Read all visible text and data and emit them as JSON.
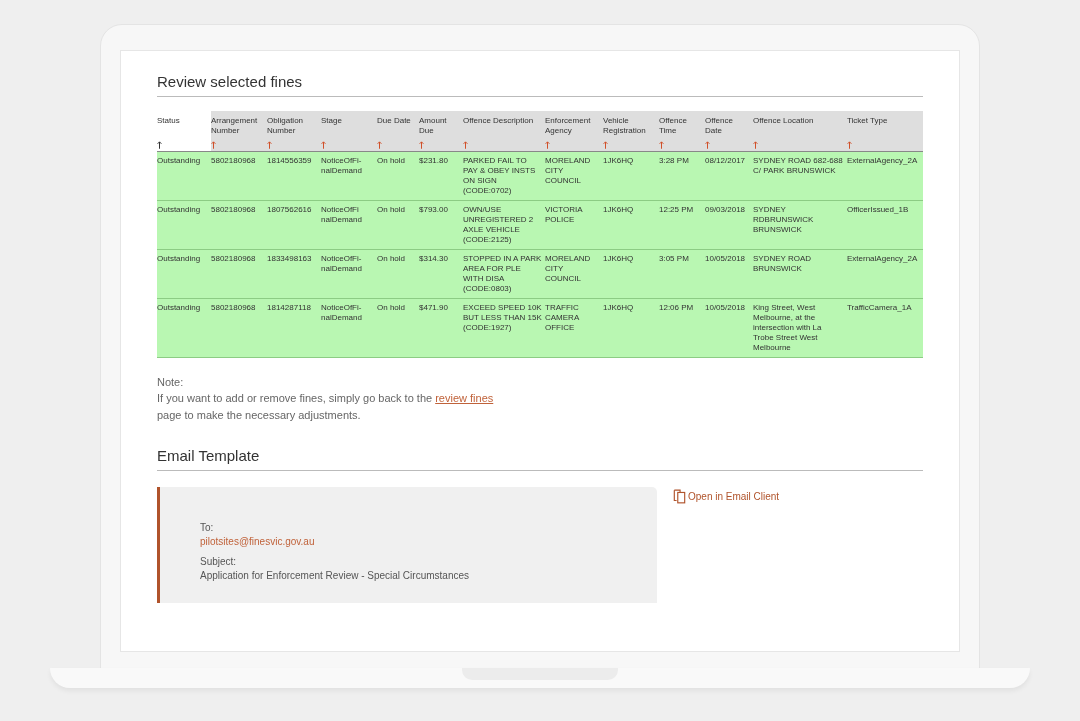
{
  "review": {
    "title": "Review selected fines",
    "table": {
      "columns": [
        {
          "label": "Status",
          "shaded": false
        },
        {
          "label": "Arrangement Number",
          "shaded": true
        },
        {
          "label": "Obligation Number",
          "shaded": true
        },
        {
          "label": "Stage",
          "shaded": true
        },
        {
          "label": "Due Date",
          "shaded": true
        },
        {
          "label": "Amount Due",
          "shaded": true
        },
        {
          "label": "Offence Description",
          "shaded": true
        },
        {
          "label": "Enforcement Agency",
          "shaded": true
        },
        {
          "label": "Vehicle Registration",
          "shaded": true
        },
        {
          "label": "Offence Time",
          "shaded": true
        },
        {
          "label": "Offence Date",
          "shaded": true
        },
        {
          "label": "Offence Location",
          "shaded": true
        },
        {
          "label": "Ticket Type",
          "shaded": true
        }
      ],
      "rows": [
        {
          "highlighted": true,
          "cells": [
            "Outstanding",
            "5802180968",
            "1814556359",
            "NoticeOfFi-nalDemand",
            "On hold",
            "$231.80",
            "PARKED FAIL TO PAY & OBEY INSTS ON SIGN (CODE:0702)",
            "MORELAND CITY COUNCIL",
            "1JK6HQ",
            "3:28 PM",
            "08/12/2017",
            "SYDNEY ROAD 682-688 C/ PARK BRUNSWICK",
            "ExternalAgency_2A"
          ]
        },
        {
          "highlighted": true,
          "cells": [
            "Outstanding",
            "5802180968",
            "1807562616",
            "NoticeOfFi nalDemand",
            "On hold",
            "$793.00",
            "OWN/USE UNREGISTERED 2 AXLE VEHICLE (CODE:2125)",
            "VICTORIA POLICE",
            "1JK6HQ",
            "12:25 PM",
            "09/03/2018",
            "SYDNEY RDBRUNSWICK BRUNSWICK",
            "OfficerIssued_1B"
          ]
        },
        {
          "highlighted": true,
          "cells": [
            "Outstanding",
            "5802180968",
            "1833498163",
            "NoticeOfFi-nalDemand",
            "On hold",
            "$314.30",
            "STOPPED IN A PARK AREA FOR PLE WITH DISA (CODE:0803)",
            "MORELAND CITY COUNCIL",
            "1JK6HQ",
            "3:05 PM",
            "10/05/2018",
            "SYDNEY ROAD BRUNSWICK",
            "ExternalAgency_2A"
          ]
        },
        {
          "highlighted": true,
          "cells": [
            "Outstanding",
            "5802180968",
            "1814287118",
            "NoticeOfFi-nalDemand",
            "On hold",
            "$471.90",
            "EXCEED SPEED 10K BUT LESS THAN 15K (CODE:1927)",
            "TRAFFIC CAMERA OFFICE",
            "1JK6HQ",
            "12:06 PM",
            "10/05/2018",
            "King Street, West Melbourne, at the intersection with La Trobe Street West Melbourne",
            "TrafficCamera_1A"
          ]
        }
      ]
    }
  },
  "note": {
    "label": "Note:",
    "text_before": "If you want to add or remove fines, simply go back to the",
    "link": "review fines",
    "text_after": "page to make the necessary adjustments."
  },
  "email": {
    "title": "Email Template",
    "to_label": "To:",
    "to": "pilotsites@finesvic.gov.au",
    "subject_label": "Subject:",
    "subject": "Application for Enforcement Review - Special Circumstances",
    "open_link": "Open in Email Client"
  }
}
